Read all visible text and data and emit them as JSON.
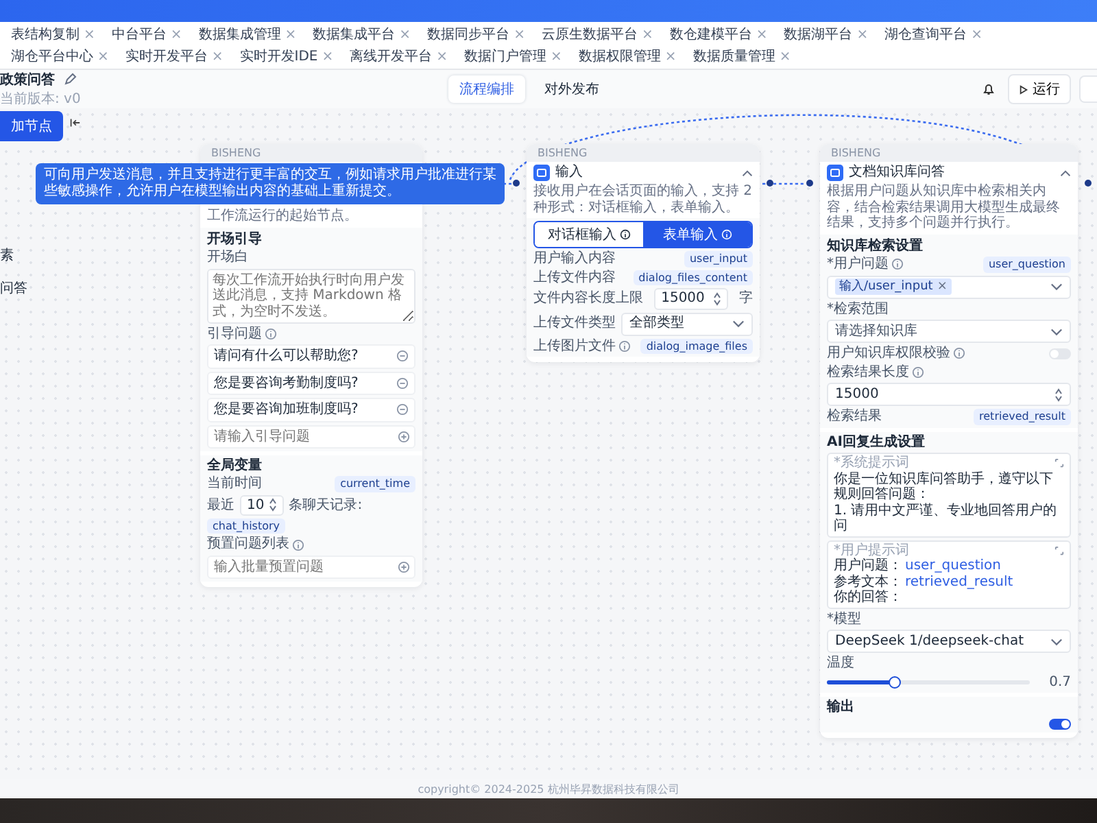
{
  "top_tabs": [
    {
      "label": "表结构复制"
    },
    {
      "label": "中台平台"
    },
    {
      "label": "数据集成管理"
    },
    {
      "label": "数据集成平台"
    },
    {
      "label": "数据同步平台"
    },
    {
      "label": "云原生数据平台"
    },
    {
      "label": "数仓建模平台"
    },
    {
      "label": "数据湖平台"
    },
    {
      "label": "湖仓查询平台"
    },
    {
      "label": "湖仓平台中心"
    },
    {
      "label": "实时开发平台"
    },
    {
      "label": "实时开发IDE"
    },
    {
      "label": "离线开发平台"
    },
    {
      "label": "数据门户管理"
    },
    {
      "label": "数据权限管理"
    },
    {
      "label": "数据质量管理"
    }
  ],
  "tab_close": "×",
  "header": {
    "title": "政策问答",
    "subtitle": "当前版本: v0",
    "modes": [
      {
        "label": "流程编排",
        "selected": true
      },
      {
        "label": "对外发布",
        "selected": false
      }
    ],
    "run_button": "运行"
  },
  "sidebar": {
    "add_button": "加节点",
    "items": [
      "素",
      "问答"
    ]
  },
  "tooltip": "可向用户发送消息，并且支持进行更丰富的交互，例如请求用户批准进行某些敏感操作，允许用户在模型输出内容的基础上重新提交。",
  "nodes": [
    {
      "brand": "BISHENG",
      "desc": "工作流运行的起始节点。",
      "rows": [
        {
          "kind": "section",
          "text": "开场引导"
        },
        {
          "kind": "label",
          "text": "开场白",
          "info": false
        },
        {
          "kind": "textarea",
          "placeholder": "每次工作流开始执行时向用户发送此消息，支持 Markdown 格式，为空时不发送。"
        },
        {
          "kind": "label",
          "text": "引导问题",
          "info": true
        },
        {
          "kind": "option",
          "text": "请问有什么可以帮助您?"
        },
        {
          "kind": "option",
          "text": "您是要咨询考勤制度吗?"
        },
        {
          "kind": "option",
          "text": "您是要咨询加班制度吗?"
        },
        {
          "kind": "add_input",
          "placeholder": "请输入引导问题"
        },
        {
          "kind": "divider_section",
          "text": "全局变量"
        },
        {
          "kind": "tag_row",
          "label": "当前时间",
          "info": false,
          "tag": "current_time"
        },
        {
          "kind": "history_row",
          "prefix": "最近",
          "value": "10",
          "suffix": "条聊天记录:",
          "tag": "chat_history"
        },
        {
          "kind": "label",
          "text": "预置问题列表",
          "info": true
        },
        {
          "kind": "add_input",
          "placeholder": "输入批量预置问题"
        }
      ]
    },
    {
      "brand": "BISHENG",
      "title": "输入",
      "desc": "接收用户在会话页面的输入，支持 2 种形式：对话框输入，表单输入。",
      "rows": [
        {
          "kind": "segmented",
          "options": [
            {
              "label": "对话框输入",
              "selected": false
            },
            {
              "label": "表单输入",
              "selected": true
            }
          ]
        },
        {
          "kind": "tag_row",
          "label": "用户输入内容",
          "info": false,
          "tag": "user_input"
        },
        {
          "kind": "tag_row",
          "label": "上传文件内容",
          "info": false,
          "tag": "dialog_files_content"
        },
        {
          "kind": "number_row",
          "label": "文件内容长度上限",
          "value": "15000",
          "unit": "字"
        },
        {
          "kind": "select_row",
          "label": "上传文件类型",
          "value": "全部类型"
        },
        {
          "kind": "tag_row",
          "label": "上传图片文件",
          "info": true,
          "tag": "dialog_image_files"
        }
      ]
    },
    {
      "brand": "BISHENG",
      "title": "文档知识库问答",
      "desc": "根据用户问题从知识库中检索相关内容，结合检索结果调用大模型生成最终结果，支持多个问题并行执行。",
      "rows": [
        {
          "kind": "section",
          "text": "知识库检索设置"
        },
        {
          "kind": "tag_row",
          "label": "*用户问题",
          "info": true,
          "tag": "user_question"
        },
        {
          "kind": "chip_select",
          "chip": "输入/user_input",
          "remove": "×"
        },
        {
          "kind": "label",
          "text": "*检索范围",
          "info": false
        },
        {
          "kind": "select",
          "placeholder": "请选择知识库"
        },
        {
          "kind": "toggle_row",
          "label": "用户知识库权限校验",
          "info": true,
          "on": false
        },
        {
          "kind": "label",
          "text": "检索结果长度",
          "info": true
        },
        {
          "kind": "number",
          "value": "15000"
        },
        {
          "kind": "tag_row",
          "label": "检索结果",
          "info": false,
          "tag": "retrieved_result"
        },
        {
          "kind": "divider_section",
          "text": "AI回复生成设置"
        },
        {
          "kind": "prompt",
          "label": "*系统提示词",
          "lines": [
            {
              "text": "你是一位知识库问答助手，遵守以下规则回答问题："
            },
            {
              "text": "1. 请用中文严谨、专业地回答用户的问"
            }
          ]
        },
        {
          "kind": "prompt",
          "label": "*用户提示词",
          "lines": [
            {
              "text": "用户问题：",
              "var": "user_question"
            },
            {
              "text": "参考文本：",
              "var": "retrieved_result"
            },
            {
              "text": "你的回答："
            }
          ]
        },
        {
          "kind": "label",
          "text": "*模型",
          "info": false
        },
        {
          "kind": "select",
          "value": "DeepSeek 1/deepseek-chat"
        },
        {
          "kind": "label",
          "text": "温度",
          "info": false
        },
        {
          "kind": "slider",
          "level": 0.33,
          "reading": "0.7"
        },
        {
          "kind": "divider_section",
          "text": "输出"
        },
        {
          "kind": "toggle",
          "on": true
        }
      ]
    }
  ],
  "footer": "copyright© 2024-2025 杭州毕昇数据科技有限公司"
}
